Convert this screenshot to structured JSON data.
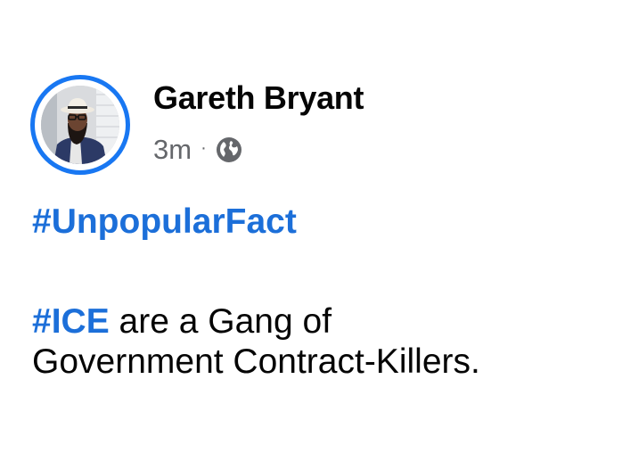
{
  "post": {
    "author": {
      "name": "Gareth Bryant",
      "avatar_icon": "profile-photo"
    },
    "meta": {
      "timestamp": "3m",
      "separator": "·",
      "privacy_icon": "globe-icon"
    },
    "body": {
      "paragraph1": {
        "hashtag": "#UnpopularFact"
      },
      "paragraph2": {
        "hashtag": "#ICE",
        "text_line1": " are a Gang of",
        "text_line2": "Government Contract-Killers."
      }
    },
    "colors": {
      "accent": "#1877f2",
      "hashtag": "#1c6fd9",
      "text": "#050505",
      "muted": "#65676b"
    }
  }
}
